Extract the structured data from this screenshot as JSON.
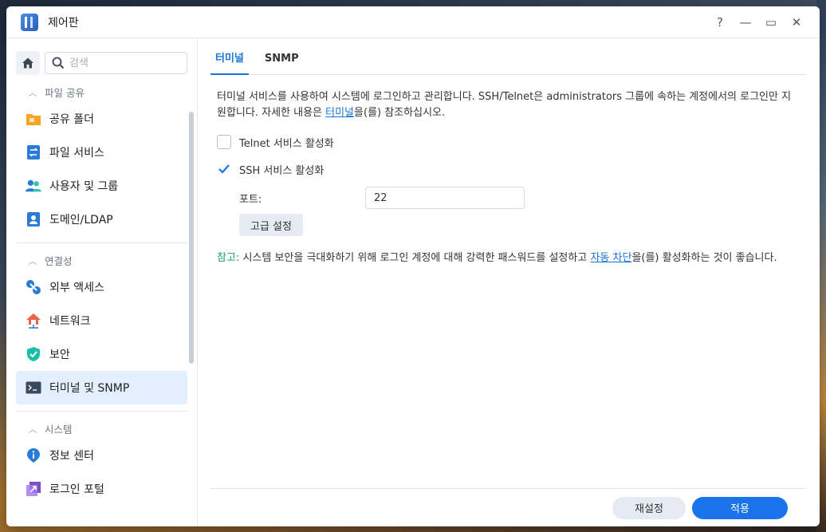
{
  "window": {
    "title": "제어판",
    "controls": [
      "?",
      "—",
      "▭",
      "✕"
    ]
  },
  "sidebar": {
    "search_placeholder": "검색",
    "groups": [
      {
        "label": "파일 공유",
        "items": [
          {
            "label": "공유 폴더",
            "icon": "shared-folder-icon"
          },
          {
            "label": "파일 서비스",
            "icon": "file-services-icon"
          },
          {
            "label": "사용자 및 그룹",
            "icon": "users-groups-icon"
          },
          {
            "label": "도메인/LDAP",
            "icon": "domain-ldap-icon"
          }
        ]
      },
      {
        "label": "연결성",
        "items": [
          {
            "label": "외부 액세스",
            "icon": "external-access-icon"
          },
          {
            "label": "네트워크",
            "icon": "network-icon"
          },
          {
            "label": "보안",
            "icon": "security-shield-icon"
          },
          {
            "label": "터미널 및 SNMP",
            "icon": "terminal-icon",
            "active": true
          }
        ]
      },
      {
        "label": "시스템",
        "items": [
          {
            "label": "정보 센터",
            "icon": "info-center-icon"
          },
          {
            "label": "로그인 포털",
            "icon": "login-portal-icon"
          }
        ]
      }
    ]
  },
  "tabs": [
    {
      "label": "터미널",
      "active": true
    },
    {
      "label": "SNMP",
      "active": false
    }
  ],
  "main": {
    "desc_part1": "터미널 서비스를 사용하여 시스템에 로그인하고 관리합니다. SSH/Telnet은 administrators 그룹에 속하는 계정에서의 로그인만 지원합니다. 자세한 내용은 ",
    "desc_link": "터미널",
    "desc_part2": "을(를) 참조하십시오.",
    "telnet_label": "Telnet 서비스 활성화",
    "telnet_checked": false,
    "ssh_label": "SSH 서비스 활성화",
    "ssh_checked": true,
    "port_label": "포트:",
    "port_value": "22",
    "advanced_label": "고급 설정",
    "note_label": "참고:",
    "note_part1": " 시스템 보안을 극대화하기 위해 로그인 계정에 대해 강력한 패스워드를 설정하고 ",
    "note_link": "자동 차단",
    "note_part2": "을(를) 활성화하는 것이 좋습니다."
  },
  "footer": {
    "reset_label": "재설정",
    "apply_label": "적용"
  },
  "colors": {
    "accent": "#1a73e8",
    "note_green": "#1aa06a",
    "active_bg": "#e3effd"
  }
}
